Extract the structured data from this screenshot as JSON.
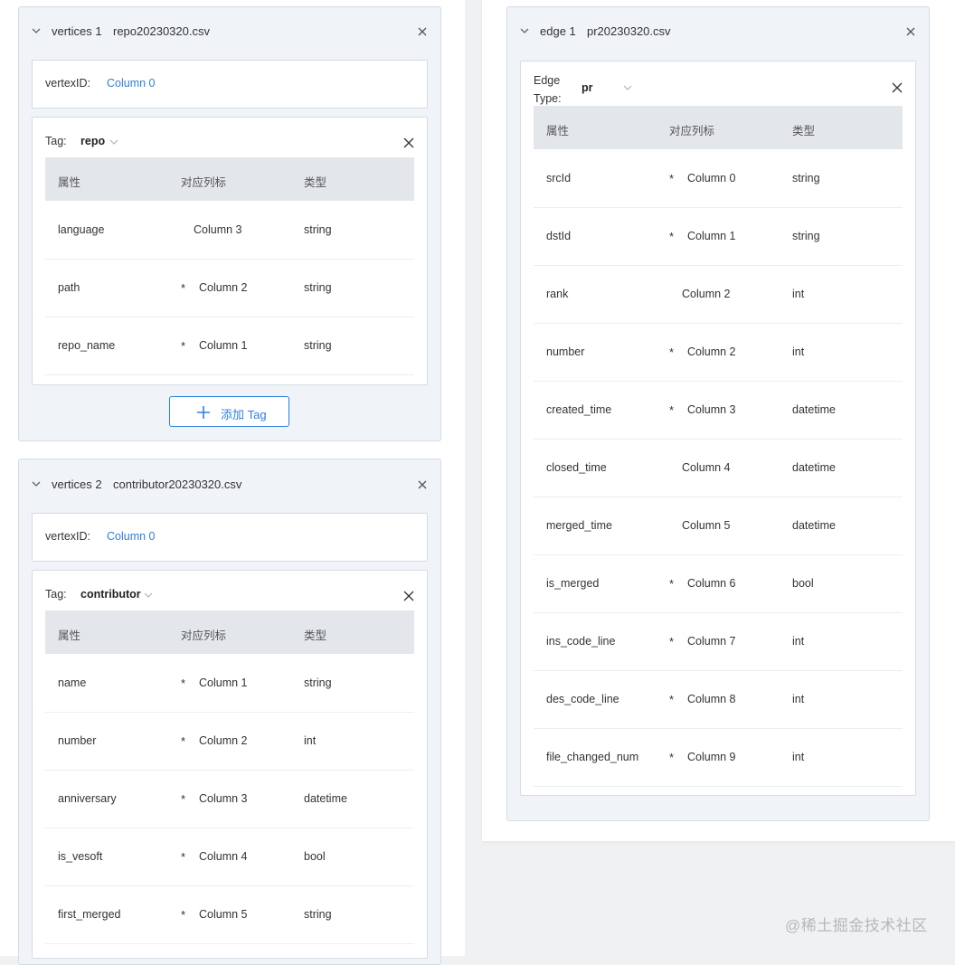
{
  "left": {
    "cards": [
      {
        "kind": "vertices 1",
        "file": "repo20230320.csv",
        "vertex_id_label": "vertexID:",
        "vertex_id_value": "Column 0",
        "tag_label": "Tag:",
        "tag_value": "repo",
        "headers": [
          "属性",
          "对应列标",
          "类型"
        ],
        "rows": [
          {
            "prop": "language",
            "required": false,
            "column": "Column 3",
            "type": "string"
          },
          {
            "prop": "path",
            "required": true,
            "column": "Column 2",
            "type": "string"
          },
          {
            "prop": "repo_name",
            "required": true,
            "column": "Column 1",
            "type": "string"
          }
        ],
        "add_tag_label": "添加 Tag"
      },
      {
        "kind": "vertices 2",
        "file": "contributor20230320.csv",
        "vertex_id_label": "vertexID:",
        "vertex_id_value": "Column 0",
        "tag_label": "Tag:",
        "tag_value": "contributor",
        "headers": [
          "属性",
          "对应列标",
          "类型"
        ],
        "rows": [
          {
            "prop": "name",
            "required": true,
            "column": "Column 1",
            "type": "string"
          },
          {
            "prop": "number",
            "required": true,
            "column": "Column 2",
            "type": "int"
          },
          {
            "prop": "anniversary",
            "required": true,
            "column": "Column 3",
            "type": "datetime"
          },
          {
            "prop": "is_vesoft",
            "required": true,
            "column": "Column 4",
            "type": "bool"
          },
          {
            "prop": "first_merged",
            "required": true,
            "column": "Column 5",
            "type": "string"
          }
        ]
      }
    ]
  },
  "right": {
    "kind": "edge 1",
    "file": "pr20230320.csv",
    "edge_type_label_line1": "Edge",
    "edge_type_label_line2": "Type:",
    "edge_type_value": "pr",
    "headers": [
      "属性",
      "对应列标",
      "类型"
    ],
    "rows": [
      {
        "prop": "srcId",
        "required": true,
        "column": "Column 0",
        "type": "string"
      },
      {
        "prop": "dstId",
        "required": true,
        "column": "Column 1",
        "type": "string"
      },
      {
        "prop": "rank",
        "required": false,
        "column": "Column 2",
        "type": "int"
      },
      {
        "prop": "number",
        "required": true,
        "column": "Column 2",
        "type": "int"
      },
      {
        "prop": "created_time",
        "required": true,
        "column": "Column 3",
        "type": "datetime"
      },
      {
        "prop": "closed_time",
        "required": false,
        "column": "Column 4",
        "type": "datetime"
      },
      {
        "prop": "merged_time",
        "required": false,
        "column": "Column 5",
        "type": "datetime"
      },
      {
        "prop": "is_merged",
        "required": true,
        "column": "Column 6",
        "type": "bool"
      },
      {
        "prop": "ins_code_line",
        "required": true,
        "column": "Column 7",
        "type": "int"
      },
      {
        "prop": "des_code_line",
        "required": true,
        "column": "Column 8",
        "type": "int"
      },
      {
        "prop": "file_changed_num",
        "required": true,
        "column": "Column 9",
        "type": "int"
      }
    ]
  },
  "required_marker": "*",
  "watermark": "@稀土掘金技术社区",
  "colors": {
    "link": "#2f7ee0",
    "card_bg": "#f0f3f8",
    "header_bg": "#e3e7eb"
  },
  "icons": [
    "chevron-down-icon",
    "close-icon",
    "plus-icon",
    "caret-down-icon"
  ]
}
